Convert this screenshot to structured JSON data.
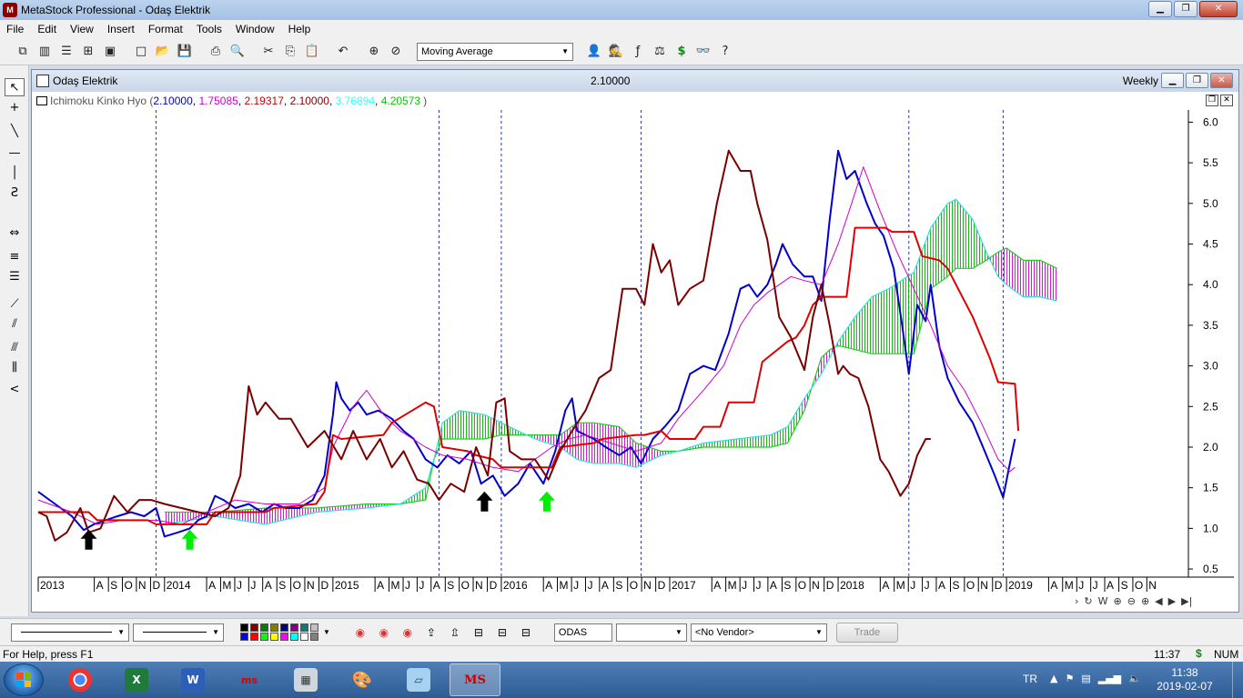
{
  "window": {
    "title": "MetaStock Professional - Odaş Elektrik"
  },
  "menu": [
    "File",
    "Edit",
    "View",
    "Insert",
    "Format",
    "Tools",
    "Window",
    "Help"
  ],
  "toolbar": {
    "indicator_select": "Moving Average"
  },
  "chart_window": {
    "name": "Odaş Elektrik",
    "last_price": "2.10000",
    "periodicity": "Weekly"
  },
  "indicator": {
    "name": "Ichimoku Kinko Hyo (",
    "values": [
      {
        "text": "2.10000",
        "color": "#0000cc"
      },
      {
        "text": "1.75085",
        "color": "#cc00cc"
      },
      {
        "text": "2.19317",
        "color": "#cc0000"
      },
      {
        "text": "2.10000",
        "color": "#800000"
      },
      {
        "text": "3.76894",
        "color": "#33ffff"
      },
      {
        "text": "4.20573",
        "color": "#00cc00"
      }
    ],
    "close_paren": ")"
  },
  "bottom_bar": {
    "symbol": "ODAS",
    "vendor": "<No Vendor>",
    "trade_label": "Trade"
  },
  "status_bar": {
    "help_text": "For Help, press F1",
    "time": "11:37",
    "currency": "$",
    "num": "NUM"
  },
  "taskbar": {
    "language": "TR",
    "clock_time": "11:38",
    "clock_date": "2019-02-07",
    "ms_label": "MS"
  },
  "colors": {
    "tenkan": "#0000cc",
    "kijun": "#cc00cc",
    "senkou_b_line": "#e00000",
    "chikou": "#7a0000",
    "senkou_a": "#30e0e0",
    "kumo_line": "#22cc22",
    "bull_cloud": "#00b000",
    "bear_cloud": "#cc00cc"
  },
  "chart_data": {
    "type": "line",
    "title": "",
    "xlabel": "",
    "ylabel": "",
    "ylim": [
      0.4,
      6.15
    ],
    "y_ticks": [
      6.0,
      5.5,
      5.0,
      4.5,
      4.0,
      3.5,
      3.0,
      2.5,
      2.0,
      1.5,
      1.0,
      0.5
    ],
    "x_range": [
      2013.25,
      2020.08
    ],
    "x_tick_labels": [
      {
        "t": 2013.25,
        "l": "2013"
      },
      {
        "t": 2013.583,
        "l": "A"
      },
      {
        "t": 2013.667,
        "l": "S"
      },
      {
        "t": 2013.75,
        "l": "O"
      },
      {
        "t": 2013.833,
        "l": "N"
      },
      {
        "t": 2013.917,
        "l": "D"
      },
      {
        "t": 2014.0,
        "l": "2014"
      },
      {
        "t": 2014.25,
        "l": "A"
      },
      {
        "t": 2014.333,
        "l": "M"
      },
      {
        "t": 2014.417,
        "l": "J"
      },
      {
        "t": 2014.5,
        "l": "J"
      },
      {
        "t": 2014.583,
        "l": "A"
      },
      {
        "t": 2014.667,
        "l": "S"
      },
      {
        "t": 2014.75,
        "l": "O"
      },
      {
        "t": 2014.833,
        "l": "N"
      },
      {
        "t": 2014.917,
        "l": "D"
      },
      {
        "t": 2015.0,
        "l": "2015"
      },
      {
        "t": 2015.25,
        "l": "A"
      },
      {
        "t": 2015.333,
        "l": "M"
      },
      {
        "t": 2015.417,
        "l": "J"
      },
      {
        "t": 2015.5,
        "l": "J"
      },
      {
        "t": 2015.583,
        "l": "A"
      },
      {
        "t": 2015.667,
        "l": "S"
      },
      {
        "t": 2015.75,
        "l": "O"
      },
      {
        "t": 2015.833,
        "l": "N"
      },
      {
        "t": 2015.917,
        "l": "D"
      },
      {
        "t": 2016.0,
        "l": "2016"
      },
      {
        "t": 2016.25,
        "l": "A"
      },
      {
        "t": 2016.333,
        "l": "M"
      },
      {
        "t": 2016.417,
        "l": "J"
      },
      {
        "t": 2016.5,
        "l": "J"
      },
      {
        "t": 2016.583,
        "l": "A"
      },
      {
        "t": 2016.667,
        "l": "S"
      },
      {
        "t": 2016.75,
        "l": "O"
      },
      {
        "t": 2016.833,
        "l": "N"
      },
      {
        "t": 2016.917,
        "l": "D"
      },
      {
        "t": 2017.0,
        "l": "2017"
      },
      {
        "t": 2017.25,
        "l": "A"
      },
      {
        "t": 2017.333,
        "l": "M"
      },
      {
        "t": 2017.417,
        "l": "J"
      },
      {
        "t": 2017.5,
        "l": "J"
      },
      {
        "t": 2017.583,
        "l": "A"
      },
      {
        "t": 2017.667,
        "l": "S"
      },
      {
        "t": 2017.75,
        "l": "O"
      },
      {
        "t": 2017.833,
        "l": "N"
      },
      {
        "t": 2017.917,
        "l": "D"
      },
      {
        "t": 2018.0,
        "l": "2018"
      },
      {
        "t": 2018.25,
        "l": "A"
      },
      {
        "t": 2018.333,
        "l": "M"
      },
      {
        "t": 2018.417,
        "l": "J"
      },
      {
        "t": 2018.5,
        "l": "J"
      },
      {
        "t": 2018.583,
        "l": "A"
      },
      {
        "t": 2018.667,
        "l": "S"
      },
      {
        "t": 2018.75,
        "l": "O"
      },
      {
        "t": 2018.833,
        "l": "N"
      },
      {
        "t": 2018.917,
        "l": "D"
      },
      {
        "t": 2019.0,
        "l": "2019"
      },
      {
        "t": 2019.25,
        "l": "A"
      },
      {
        "t": 2019.333,
        "l": "M"
      },
      {
        "t": 2019.417,
        "l": "J"
      },
      {
        "t": 2019.5,
        "l": "J"
      },
      {
        "t": 2019.583,
        "l": "A"
      },
      {
        "t": 2019.667,
        "l": "S"
      },
      {
        "t": 2019.75,
        "l": "O"
      },
      {
        "t": 2019.833,
        "l": "N"
      }
    ],
    "vertical_markers": [
      2013.95,
      2015.63,
      2016.0,
      2016.83,
      2018.42,
      2018.98
    ],
    "arrows": [
      {
        "x": 2013.55,
        "y": 0.85,
        "color": "#000000"
      },
      {
        "x": 2014.15,
        "y": 0.85,
        "color": "#00ee00"
      },
      {
        "x": 2015.9,
        "y": 1.32,
        "color": "#000000"
      },
      {
        "x": 2016.27,
        "y": 1.32,
        "color": "#00ee00"
      }
    ],
    "series": [
      {
        "key": "tenkan",
        "color": "#0000cc",
        "width": 2,
        "x": [
          2013.25,
          2013.35,
          2013.45,
          2013.52,
          2013.58,
          2013.65,
          2013.72,
          2013.8,
          2013.88,
          2013.95,
          2014.0,
          2014.08,
          2014.15,
          2014.2,
          2014.25,
          2014.3,
          2014.35,
          2014.42,
          2014.5,
          2014.58,
          2014.65,
          2014.72,
          2014.8,
          2014.88,
          2014.95,
          2015.0,
          2015.02,
          2015.05,
          2015.1,
          2015.15,
          2015.2,
          2015.27,
          2015.35,
          2015.42,
          2015.48,
          2015.55,
          2015.62,
          2015.68,
          2015.75,
          2015.82,
          2015.88,
          2015.95,
          2016.02,
          2016.1,
          2016.17,
          2016.25,
          2016.32,
          2016.38,
          2016.42,
          2016.45,
          2016.5,
          2016.55,
          2016.62,
          2016.7,
          2016.77,
          2016.83,
          2016.9,
          2016.97,
          2017.05,
          2017.12,
          2017.2,
          2017.27,
          2017.35,
          2017.42,
          2017.47,
          2017.52,
          2017.58,
          2017.63,
          2017.67,
          2017.73,
          2017.8,
          2017.85,
          2017.9,
          2017.95,
          2018.0,
          2018.05,
          2018.1,
          2018.17,
          2018.22,
          2018.27,
          2018.33,
          2018.38,
          2018.42,
          2018.47,
          2018.52,
          2018.55,
          2018.6,
          2018.65,
          2018.72,
          2018.8,
          2018.87,
          2018.93,
          2018.98,
          2019.02,
          2019.05
        ],
        "y": [
          1.45,
          1.3,
          1.15,
          0.98,
          1.05,
          1.1,
          1.15,
          1.2,
          1.15,
          1.25,
          0.9,
          0.95,
          1.0,
          1.1,
          1.15,
          1.4,
          1.35,
          1.25,
          1.3,
          1.2,
          1.3,
          1.25,
          1.25,
          1.35,
          1.65,
          2.4,
          2.8,
          2.6,
          2.45,
          2.55,
          2.4,
          2.45,
          2.35,
          2.2,
          2.1,
          1.85,
          1.75,
          1.9,
          1.8,
          1.95,
          1.55,
          1.65,
          1.4,
          1.55,
          1.8,
          1.55,
          1.95,
          2.45,
          2.6,
          2.2,
          2.15,
          2.1,
          2.0,
          1.9,
          2.0,
          1.8,
          2.1,
          2.25,
          2.45,
          2.9,
          3.0,
          2.95,
          3.4,
          3.95,
          4.0,
          3.85,
          4.0,
          4.25,
          4.5,
          4.25,
          4.1,
          4.1,
          3.8,
          4.8,
          5.65,
          5.3,
          5.4,
          5.0,
          4.75,
          4.6,
          4.2,
          3.5,
          2.9,
          3.75,
          3.55,
          4.0,
          3.25,
          2.85,
          2.55,
          2.3,
          1.95,
          1.65,
          1.38,
          1.8,
          2.1
        ]
      },
      {
        "key": "kijun",
        "color": "#cc00cc",
        "width": 1,
        "x": [
          2013.25,
          2013.45,
          2013.6,
          2013.75,
          2013.95,
          2014.1,
          2014.25,
          2014.42,
          2014.6,
          2014.8,
          2014.95,
          2015.0,
          2015.12,
          2015.2,
          2015.3,
          2015.4,
          2015.55,
          2015.65,
          2015.8,
          2015.95,
          2016.1,
          2016.2,
          2016.3,
          2016.4,
          2016.5,
          2016.65,
          2016.8,
          2016.95,
          2017.05,
          2017.2,
          2017.32,
          2017.42,
          2017.5,
          2017.58,
          2017.65,
          2017.72,
          2017.8,
          2017.9,
          2018.0,
          2018.08,
          2018.15,
          2018.25,
          2018.35,
          2018.45,
          2018.55,
          2018.65,
          2018.75,
          2018.85,
          2018.95,
          2019.02,
          2019.05
        ],
        "y": [
          1.35,
          1.2,
          1.05,
          1.1,
          1.1,
          1.05,
          1.2,
          1.35,
          1.3,
          1.3,
          1.5,
          2.0,
          2.5,
          2.7,
          2.4,
          2.2,
          2.0,
          1.9,
          1.85,
          1.75,
          1.7,
          1.85,
          2.0,
          2.1,
          2.15,
          2.05,
          1.95,
          2.05,
          2.35,
          2.7,
          3.0,
          3.5,
          3.75,
          3.9,
          4.0,
          4.1,
          4.05,
          4.0,
          4.5,
          5.0,
          5.45,
          4.9,
          4.4,
          3.95,
          3.5,
          3.0,
          2.7,
          2.3,
          1.85,
          1.7,
          1.75
        ]
      },
      {
        "key": "senkou_b_line",
        "color": "#e00000",
        "width": 2,
        "x": [
          2013.25,
          2013.55,
          2013.6,
          2013.9,
          2013.95,
          2014.25,
          2014.3,
          2014.6,
          2014.65,
          2014.9,
          2014.95,
          2014.98,
          2015.0,
          2015.05,
          2015.3,
          2015.35,
          2015.55,
          2015.6,
          2015.65,
          2015.8,
          2015.85,
          2015.95,
          2016.0,
          2016.1,
          2016.3,
          2016.35,
          2016.55,
          2016.6,
          2016.8,
          2016.85,
          2016.95,
          2017.0,
          2017.15,
          2017.2,
          2017.3,
          2017.35,
          2017.5,
          2017.55,
          2017.7,
          2017.75,
          2017.8,
          2017.85,
          2017.9,
          2018.05,
          2018.1,
          2018.28,
          2018.32,
          2018.45,
          2018.5,
          2018.6,
          2018.65,
          2018.7,
          2018.8,
          2018.9,
          2018.95,
          2019.05,
          2019.07
        ],
        "y": [
          1.2,
          1.2,
          1.1,
          1.1,
          1.05,
          1.05,
          1.2,
          1.2,
          1.25,
          1.3,
          1.45,
          1.85,
          2.15,
          2.1,
          2.15,
          2.3,
          2.55,
          2.5,
          2.0,
          1.95,
          1.9,
          1.85,
          1.75,
          1.75,
          1.75,
          2.0,
          2.05,
          2.1,
          2.15,
          2.15,
          2.2,
          2.1,
          2.1,
          2.25,
          2.25,
          2.55,
          2.55,
          3.05,
          3.3,
          3.35,
          3.5,
          3.75,
          3.85,
          3.85,
          4.7,
          4.7,
          4.65,
          4.65,
          4.35,
          4.3,
          4.2,
          4.0,
          3.6,
          3.1,
          2.8,
          2.78,
          2.2
        ]
      },
      {
        "key": "chikou",
        "color": "#7a0000",
        "width": 2,
        "x": [
          2013.25,
          2013.3,
          2013.35,
          2013.42,
          2013.5,
          2013.55,
          2013.62,
          2013.7,
          2013.78,
          2013.85,
          2013.92,
          2014.0,
          2014.1,
          2014.2,
          2014.3,
          2014.38,
          2014.45,
          2014.5,
          2014.55,
          2014.6,
          2014.68,
          2014.75,
          2014.85,
          2014.95,
          2015.05,
          2015.12,
          2015.2,
          2015.28,
          2015.35,
          2015.42,
          2015.5,
          2015.57,
          2015.63,
          2015.7,
          2015.78,
          2015.85,
          2015.92,
          2015.97,
          2016.02,
          2016.05,
          2016.12,
          2016.2,
          2016.28,
          2016.35,
          2016.42,
          2016.5,
          2016.58,
          2016.65,
          2016.72,
          2016.8,
          2016.85,
          2016.9,
          2016.95,
          2017.0,
          2017.05,
          2017.12,
          2017.2,
          2017.28,
          2017.35,
          2017.42,
          2017.48,
          2017.52,
          2017.58,
          2017.65,
          2017.72,
          2017.8,
          2017.85,
          2017.9,
          2017.95,
          2018.0,
          2018.03,
          2018.07,
          2018.12,
          2018.18,
          2018.25,
          2018.3,
          2018.37,
          2018.42,
          2018.47,
          2018.52,
          2018.55
        ],
        "y": [
          1.2,
          1.15,
          0.85,
          0.95,
          1.25,
          0.95,
          1.0,
          1.4,
          1.2,
          1.35,
          1.35,
          1.3,
          1.25,
          1.2,
          1.15,
          1.25,
          1.65,
          2.75,
          2.4,
          2.55,
          2.35,
          2.35,
          2.0,
          2.2,
          1.85,
          2.2,
          1.85,
          2.1,
          1.75,
          1.95,
          1.6,
          1.55,
          1.35,
          1.55,
          1.45,
          2.0,
          1.65,
          2.55,
          2.6,
          1.95,
          1.85,
          1.85,
          1.6,
          1.95,
          2.2,
          2.45,
          2.85,
          2.95,
          3.95,
          3.95,
          3.75,
          4.5,
          4.15,
          4.3,
          3.75,
          3.95,
          4.05,
          5.0,
          5.65,
          5.4,
          5.4,
          5.0,
          4.55,
          3.6,
          3.35,
          2.95,
          3.6,
          4.0,
          3.5,
          2.9,
          3.0,
          2.9,
          2.85,
          2.5,
          1.85,
          1.7,
          1.4,
          1.55,
          1.9,
          2.1,
          2.1
        ]
      }
    ],
    "senkou_a": {
      "x": [
        2014.0,
        2014.3,
        2014.6,
        2014.9,
        2015.2,
        2015.4,
        2015.55,
        2015.6,
        2015.65,
        2015.75,
        2015.9,
        2016.0,
        2016.2,
        2016.35,
        2016.45,
        2016.55,
        2016.7,
        2016.8,
        2016.95,
        2017.05,
        2017.2,
        2017.4,
        2017.6,
        2017.7,
        2017.8,
        2017.9,
        2017.95,
        2018.0,
        2018.1,
        2018.2,
        2018.3,
        2018.45,
        2018.55,
        2018.65,
        2018.7,
        2018.8,
        2018.88,
        2018.95,
        2019.0,
        2019.1,
        2019.2,
        2019.3
      ],
      "y": [
        1.05,
        1.15,
        1.05,
        1.2,
        1.25,
        1.3,
        1.5,
        1.85,
        2.3,
        2.45,
        2.4,
        2.3,
        2.1,
        2.0,
        1.85,
        1.8,
        1.8,
        1.75,
        1.9,
        1.95,
        2.05,
        2.1,
        2.15,
        2.25,
        2.6,
        2.9,
        3.1,
        3.3,
        3.6,
        3.85,
        3.95,
        4.15,
        4.7,
        5.0,
        5.05,
        4.8,
        4.4,
        4.1,
        4.0,
        3.85,
        3.85,
        3.8
      ]
    },
    "senkou_b": {
      "x": [
        2014.0,
        2014.3,
        2014.6,
        2014.9,
        2015.2,
        2015.4,
        2015.55,
        2015.6,
        2015.65,
        2015.75,
        2015.9,
        2016.0,
        2016.2,
        2016.35,
        2016.45,
        2016.55,
        2016.7,
        2016.8,
        2016.95,
        2017.05,
        2017.2,
        2017.4,
        2017.6,
        2017.7,
        2017.8,
        2017.9,
        2017.95,
        2018.0,
        2018.1,
        2018.2,
        2018.3,
        2018.45,
        2018.55,
        2018.65,
        2018.7,
        2018.8,
        2018.88,
        2018.95,
        2019.0,
        2019.1,
        2019.2,
        2019.3
      ],
      "y": [
        1.2,
        1.2,
        1.25,
        1.25,
        1.3,
        1.3,
        1.35,
        1.85,
        2.1,
        2.1,
        2.1,
        2.15,
        2.15,
        2.15,
        2.3,
        2.3,
        2.25,
        2.05,
        1.95,
        1.95,
        2.0,
        2.0,
        2.0,
        2.05,
        2.45,
        3.1,
        3.2,
        3.25,
        3.2,
        3.15,
        3.15,
        3.15,
        3.95,
        4.1,
        4.2,
        4.2,
        4.3,
        4.4,
        4.45,
        4.3,
        4.3,
        4.2
      ]
    }
  }
}
